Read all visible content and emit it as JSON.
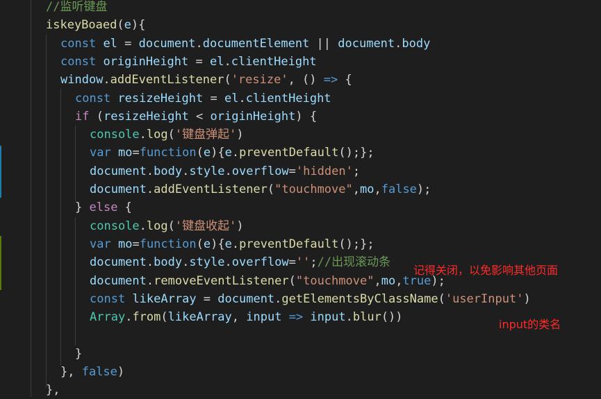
{
  "colors": {
    "background": "#1e1e1e",
    "comment": "#6a9955",
    "keyword": "#569cd6",
    "control": "#c586c0",
    "function": "#dcdcaa",
    "variable": "#9cdcfe",
    "string": "#ce9178",
    "class": "#4ec9b0",
    "punctuation": "#d4d4d4",
    "annotation": "#ff2a2a"
  },
  "code_lines": [
    {
      "tokens": [
        {
          "t": "//监听键盘",
          "c": "cmt"
        }
      ]
    },
    {
      "tokens": [
        {
          "t": "iskeyBoaed",
          "c": "fn"
        },
        {
          "t": "(",
          "c": "pn"
        },
        {
          "t": "e",
          "c": "vr"
        },
        {
          "t": "){",
          "c": "pn"
        }
      ]
    },
    {
      "tokens": [
        {
          "t": "const",
          "c": "kw"
        },
        {
          "t": " ",
          "c": "pn"
        },
        {
          "t": "el",
          "c": "vr"
        },
        {
          "t": " = ",
          "c": "pn"
        },
        {
          "t": "document",
          "c": "vr"
        },
        {
          "t": ".",
          "c": "pn"
        },
        {
          "t": "documentElement",
          "c": "vr"
        },
        {
          "t": " || ",
          "c": "pn"
        },
        {
          "t": "document",
          "c": "vr"
        },
        {
          "t": ".",
          "c": "pn"
        },
        {
          "t": "body",
          "c": "vr"
        }
      ]
    },
    {
      "tokens": [
        {
          "t": "const",
          "c": "kw"
        },
        {
          "t": " ",
          "c": "pn"
        },
        {
          "t": "originHeight",
          "c": "vr"
        },
        {
          "t": " = ",
          "c": "pn"
        },
        {
          "t": "el",
          "c": "vr"
        },
        {
          "t": ".",
          "c": "pn"
        },
        {
          "t": "clientHeight",
          "c": "vr"
        }
      ]
    },
    {
      "tokens": [
        {
          "t": "window",
          "c": "vr"
        },
        {
          "t": ".",
          "c": "pn"
        },
        {
          "t": "addEventListener",
          "c": "fn"
        },
        {
          "t": "(",
          "c": "pn"
        },
        {
          "t": "'resize'",
          "c": "str"
        },
        {
          "t": ", () ",
          "c": "pn"
        },
        {
          "t": "=>",
          "c": "kw"
        },
        {
          "t": " {",
          "c": "pn"
        }
      ]
    },
    {
      "tokens": [
        {
          "t": "const",
          "c": "kw"
        },
        {
          "t": " ",
          "c": "pn"
        },
        {
          "t": "resizeHeight",
          "c": "vr"
        },
        {
          "t": " = ",
          "c": "pn"
        },
        {
          "t": "el",
          "c": "vr"
        },
        {
          "t": ".",
          "c": "pn"
        },
        {
          "t": "clientHeight",
          "c": "vr"
        }
      ]
    },
    {
      "tokens": [
        {
          "t": "if",
          "c": "ctl"
        },
        {
          "t": " (",
          "c": "pn"
        },
        {
          "t": "resizeHeight",
          "c": "vr"
        },
        {
          "t": " < ",
          "c": "pn"
        },
        {
          "t": "originHeight",
          "c": "vr"
        },
        {
          "t": ") {",
          "c": "pn"
        }
      ]
    },
    {
      "tokens": [
        {
          "t": "console",
          "c": "cls"
        },
        {
          "t": ".",
          "c": "pn"
        },
        {
          "t": "log",
          "c": "fn"
        },
        {
          "t": "(",
          "c": "pn"
        },
        {
          "t": "'键盘弹起'",
          "c": "str"
        },
        {
          "t": ")",
          "c": "pn"
        }
      ]
    },
    {
      "tokens": [
        {
          "t": "var",
          "c": "kw"
        },
        {
          "t": " ",
          "c": "pn"
        },
        {
          "t": "mo",
          "c": "vr"
        },
        {
          "t": "=",
          "c": "pn"
        },
        {
          "t": "function",
          "c": "kw"
        },
        {
          "t": "(",
          "c": "pn"
        },
        {
          "t": "e",
          "c": "vr"
        },
        {
          "t": "){",
          "c": "pn"
        },
        {
          "t": "e",
          "c": "vr"
        },
        {
          "t": ".",
          "c": "pn"
        },
        {
          "t": "preventDefault",
          "c": "fn"
        },
        {
          "t": "();};",
          "c": "pn"
        }
      ]
    },
    {
      "tokens": [
        {
          "t": "document",
          "c": "vr"
        },
        {
          "t": ".",
          "c": "pn"
        },
        {
          "t": "body",
          "c": "vr"
        },
        {
          "t": ".",
          "c": "pn"
        },
        {
          "t": "style",
          "c": "vr"
        },
        {
          "t": ".",
          "c": "pn"
        },
        {
          "t": "overflow",
          "c": "vr"
        },
        {
          "t": "=",
          "c": "pn"
        },
        {
          "t": "'hidden'",
          "c": "str"
        },
        {
          "t": ";",
          "c": "pn"
        }
      ]
    },
    {
      "tokens": [
        {
          "t": "document",
          "c": "vr"
        },
        {
          "t": ".",
          "c": "pn"
        },
        {
          "t": "addEventListener",
          "c": "fn"
        },
        {
          "t": "(",
          "c": "pn"
        },
        {
          "t": "\"touchmove\"",
          "c": "str"
        },
        {
          "t": ",",
          "c": "pn"
        },
        {
          "t": "mo",
          "c": "vr"
        },
        {
          "t": ",",
          "c": "pn"
        },
        {
          "t": "false",
          "c": "kw"
        },
        {
          "t": ");",
          "c": "pn"
        }
      ]
    },
    {
      "tokens": [
        {
          "t": "} ",
          "c": "pn"
        },
        {
          "t": "else",
          "c": "ctl"
        },
        {
          "t": " {",
          "c": "pn"
        }
      ]
    },
    {
      "tokens": [
        {
          "t": "console",
          "c": "cls"
        },
        {
          "t": ".",
          "c": "pn"
        },
        {
          "t": "log",
          "c": "fn"
        },
        {
          "t": "(",
          "c": "pn"
        },
        {
          "t": "'键盘收起'",
          "c": "str"
        },
        {
          "t": ")",
          "c": "pn"
        }
      ]
    },
    {
      "tokens": [
        {
          "t": "var",
          "c": "kw"
        },
        {
          "t": " ",
          "c": "pn"
        },
        {
          "t": "mo",
          "c": "vr"
        },
        {
          "t": "=",
          "c": "pn"
        },
        {
          "t": "function",
          "c": "kw"
        },
        {
          "t": "(",
          "c": "pn"
        },
        {
          "t": "e",
          "c": "vr"
        },
        {
          "t": "){",
          "c": "pn"
        },
        {
          "t": "e",
          "c": "vr"
        },
        {
          "t": ".",
          "c": "pn"
        },
        {
          "t": "preventDefault",
          "c": "fn"
        },
        {
          "t": "();};",
          "c": "pn"
        }
      ]
    },
    {
      "tokens": [
        {
          "t": "document",
          "c": "vr"
        },
        {
          "t": ".",
          "c": "pn"
        },
        {
          "t": "body",
          "c": "vr"
        },
        {
          "t": ".",
          "c": "pn"
        },
        {
          "t": "style",
          "c": "vr"
        },
        {
          "t": ".",
          "c": "pn"
        },
        {
          "t": "overflow",
          "c": "vr"
        },
        {
          "t": "=",
          "c": "pn"
        },
        {
          "t": "''",
          "c": "str"
        },
        {
          "t": ";",
          "c": "pn"
        },
        {
          "t": "//出现滚动条",
          "c": "cmt"
        }
      ]
    },
    {
      "tokens": [
        {
          "t": "document",
          "c": "vr"
        },
        {
          "t": ".",
          "c": "pn"
        },
        {
          "t": "removeEventListener",
          "c": "fn"
        },
        {
          "t": "(",
          "c": "pn"
        },
        {
          "t": "\"touchmove\"",
          "c": "str"
        },
        {
          "t": ",",
          "c": "pn"
        },
        {
          "t": "mo",
          "c": "vr"
        },
        {
          "t": ",",
          "c": "pn"
        },
        {
          "t": "true",
          "c": "kw"
        },
        {
          "t": ");",
          "c": "pn"
        }
      ]
    },
    {
      "tokens": [
        {
          "t": "const",
          "c": "kw"
        },
        {
          "t": " ",
          "c": "pn"
        },
        {
          "t": "likeArray",
          "c": "vr"
        },
        {
          "t": " = ",
          "c": "pn"
        },
        {
          "t": "document",
          "c": "vr"
        },
        {
          "t": ".",
          "c": "pn"
        },
        {
          "t": "getElementsByClassName",
          "c": "fn"
        },
        {
          "t": "(",
          "c": "pn"
        },
        {
          "t": "'userInput'",
          "c": "str"
        },
        {
          "t": ")",
          "c": "pn"
        }
      ]
    },
    {
      "tokens": [
        {
          "t": "Array",
          "c": "cls"
        },
        {
          "t": ".",
          "c": "pn"
        },
        {
          "t": "from",
          "c": "fn"
        },
        {
          "t": "(",
          "c": "pn"
        },
        {
          "t": "likeArray",
          "c": "vr"
        },
        {
          "t": ", ",
          "c": "pn"
        },
        {
          "t": "input",
          "c": "vr"
        },
        {
          "t": " ",
          "c": "pn"
        },
        {
          "t": "=>",
          "c": "kw"
        },
        {
          "t": " ",
          "c": "pn"
        },
        {
          "t": "input",
          "c": "vr"
        },
        {
          "t": ".",
          "c": "pn"
        },
        {
          "t": "blur",
          "c": "fn"
        },
        {
          "t": "())",
          "c": "pn"
        }
      ]
    },
    {
      "tokens": []
    },
    {
      "tokens": [
        {
          "t": "}",
          "c": "pn"
        }
      ]
    },
    {
      "tokens": [
        {
          "t": "}, ",
          "c": "pn"
        },
        {
          "t": "false",
          "c": "kw"
        },
        {
          "t": ")",
          "c": "pn"
        }
      ]
    },
    {
      "tokens": [
        {
          "t": "},",
          "c": "pn"
        }
      ]
    }
  ],
  "annotations": {
    "close_note": "记得关闭，以免影响其他页面",
    "class_note": "input的类名"
  }
}
